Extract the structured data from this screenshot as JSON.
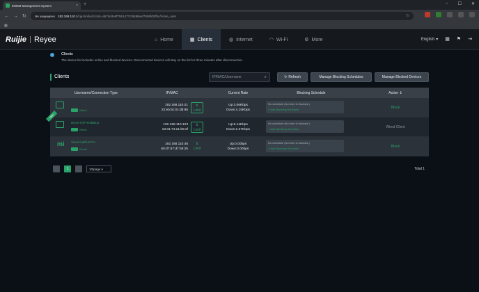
{
  "browser": {
    "tab_title": "EWEB Management System",
    "address_security": "Не защищено",
    "address_host": "192.168.110.1",
    "address_path": "/cgi-bin/luci/;stok=ab7dd4e0f7551477c0bd66ed70d8fd3/fhc/home_user"
  },
  "header": {
    "logo_brand": "Ruijie",
    "logo_product": "Reyee",
    "nav": [
      {
        "label": "Home",
        "icon": "home-icon"
      },
      {
        "label": "Clients",
        "icon": "clients-icon"
      },
      {
        "label": "Internet",
        "icon": "globe-icon"
      },
      {
        "label": "Wi-Fi",
        "icon": "wifi-icon"
      },
      {
        "label": "More",
        "icon": "gear-icon"
      }
    ],
    "language": "English"
  },
  "info": {
    "title": "Clients",
    "description": "The device list includes online and blocked devices. Disconnected devices will stay on the list for three minutes after disconnection."
  },
  "panel": {
    "title": "Clients",
    "search_placeholder": "IP/MAC/Username",
    "refresh_label": "Refresh",
    "manage_schedules_label": "Manage Blocking Schedules",
    "manage_blocked_label": "Manage Blocked Devices"
  },
  "table": {
    "headers": [
      "Username/Connection Type",
      "IP/MAC",
      "Current Rate",
      "Blocking Schedule",
      "Action"
    ],
    "rows": [
      {
        "name": "",
        "tag": "5G",
        "type": "Wired",
        "ip": "192.168.110.21",
        "mac": "22:eb:8c:0c:d8:9b",
        "limit": "Limit",
        "up": "Up:3.06Kbps",
        "down": "Down:4.15Kbps",
        "schedule": "No schedule (No time is blocked.)",
        "add_schedule": "+ Add Blocking Schedule",
        "action": "Block",
        "is_new": false
      },
      {
        "name": "DESKTOP-R4BBLD",
        "tag": "",
        "type": "Wired",
        "ip": "192.168.110.123",
        "mac": "18:31:74:21:b9:2f",
        "limit": "Limit",
        "up": "Up:8.14Kbps",
        "down": "Down:2.37Kbps",
        "schedule": "No schedule (No time is blocked.)",
        "add_schedule": "+ Add Blocking Schedule",
        "action": "Wired Client",
        "is_new": true,
        "new_label": "New"
      },
      {
        "name": "Xiaomi-Wifi-9 Pro",
        "tag": "5G",
        "type": "Guest",
        "ip": "192.168.110.46",
        "mac": "60:d7:67:d7:59:2b",
        "limit": "Limit",
        "up": "Up:0.00bps",
        "down": "Down:0.00bps",
        "schedule": "No schedule (No time is blocked.)",
        "add_schedule": "+ Add Blocking Schedule",
        "action": "Block",
        "is_new": false
      }
    ]
  },
  "pagination": {
    "current": "1",
    "per_page": "10/page",
    "total": "Total 1"
  },
  "colors": {
    "accent": "#2aa36a",
    "bg": "#0b1016"
  }
}
